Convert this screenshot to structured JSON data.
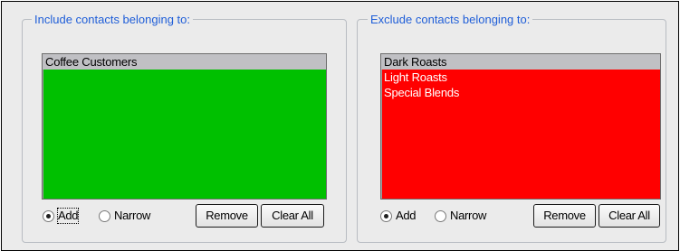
{
  "include": {
    "legend": "Include contacts belonging to:",
    "list_color": "#00c000",
    "items": [
      "Coffee Customers"
    ],
    "selected_index": 0,
    "mode": {
      "add_label": "Add",
      "narrow_label": "Narrow",
      "selected": "Add"
    },
    "remove_label": "Remove",
    "clear_all_label": "Clear All"
  },
  "exclude": {
    "legend": "Exclude contacts belonging to:",
    "list_color": "#ff0000",
    "items": [
      "Dark Roasts",
      "Light Roasts",
      "Special Blends"
    ],
    "selected_index": 0,
    "mode": {
      "add_label": "Add",
      "narrow_label": "Narrow",
      "selected": "Add"
    },
    "remove_label": "Remove",
    "clear_all_label": "Clear All"
  },
  "colors": {
    "legend_text": "#1f5ed8",
    "selected_item_bg": "#c0c0c4",
    "panel_bg": "#ebebeb"
  }
}
